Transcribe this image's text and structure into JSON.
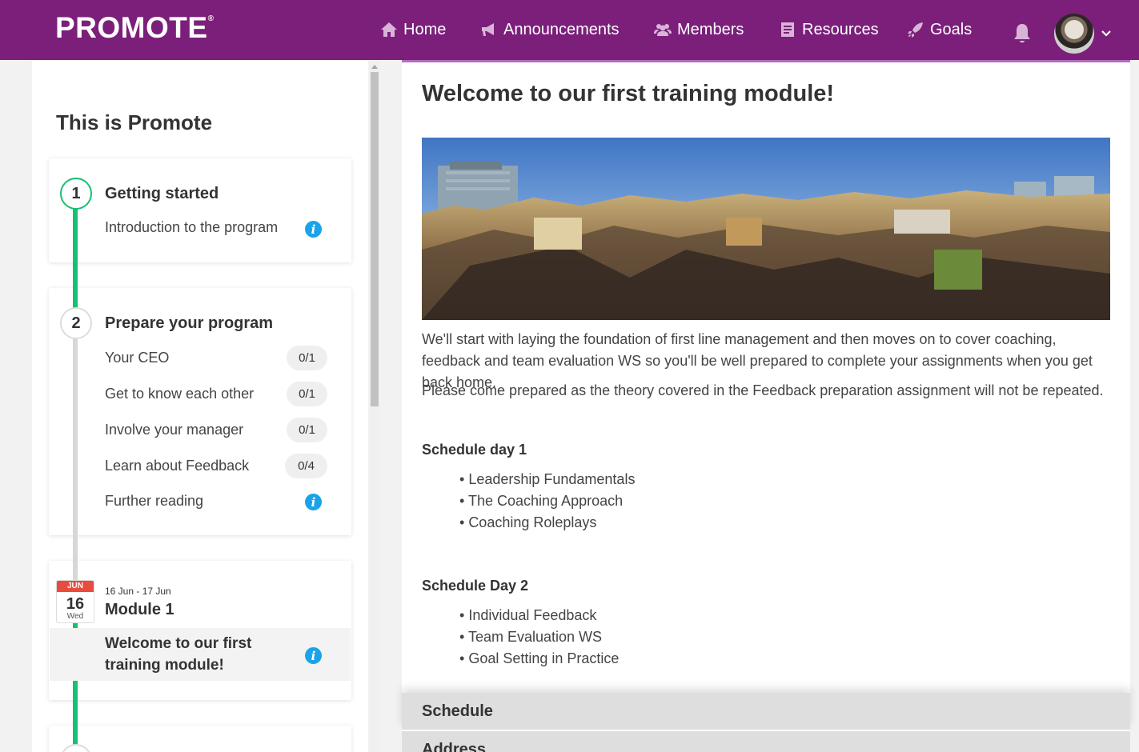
{
  "header": {
    "logo": "PROMOTE",
    "logo_mark": "®",
    "nav": [
      {
        "label": "Home",
        "icon": "home-icon"
      },
      {
        "label": "Announcements",
        "icon": "megaphone-icon"
      },
      {
        "label": "Members",
        "icon": "members-icon"
      },
      {
        "label": "Resources",
        "icon": "resources-icon"
      },
      {
        "label": "Goals",
        "icon": "rocket-icon"
      }
    ],
    "accent_color": "#7b1f7a"
  },
  "sidebar": {
    "title": "This is Promote",
    "step1": {
      "number": "1",
      "heading": "Getting started",
      "items": [
        {
          "label": "Introduction to the program"
        }
      ]
    },
    "step2": {
      "number": "2",
      "heading": "Prepare your program",
      "items": [
        {
          "label": "Your CEO",
          "badge": "0/1"
        },
        {
          "label": "Get to know each other",
          "badge": "0/1"
        },
        {
          "label": "Involve your manager",
          "badge": "0/1"
        },
        {
          "label": "Learn about Feedback",
          "badge": "0/4"
        },
        {
          "label": "Further reading"
        }
      ]
    },
    "module": {
      "cal_month": "JUN",
      "cal_day": "16",
      "cal_weekday": "Wed",
      "dates": "16 Jun - 17 Jun",
      "heading": "Module 1",
      "selected_item": "Welcome to our first training module!"
    }
  },
  "main": {
    "title": "Welcome to our first training module!",
    "paragraph1": "We'll start with laying the foundation of first line management and then moves on to cover coaching, feedback and team evaluation WS so you'll be well prepared to complete your assignments when you get back home.",
    "paragraph2": "Please come prepared as the theory covered in the Feedback preparation assignment will not be repeated.",
    "day1": {
      "title": "Schedule day 1",
      "items": [
        "Leadership Fundamentals",
        "The Coaching Approach",
        "Coaching Roleplays"
      ]
    },
    "day2": {
      "title": "Schedule Day 2",
      "items": [
        "Individual Feedback",
        "Team Evaluation WS",
        "Goal Setting in Practice"
      ]
    },
    "accordion": [
      "Schedule",
      "Address"
    ]
  }
}
